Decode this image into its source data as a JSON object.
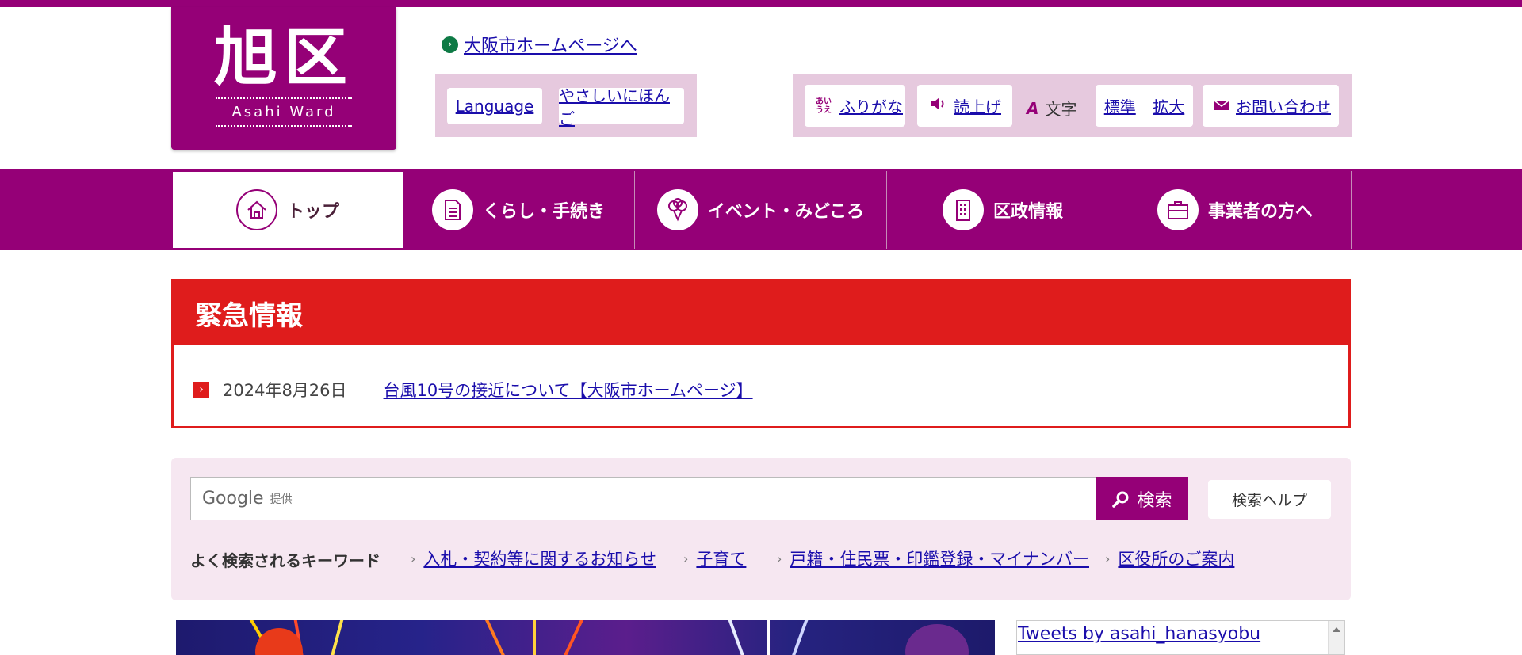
{
  "logo": {
    "kanji": "旭区",
    "english": "Asahi Ward"
  },
  "header": {
    "osaka_link": "大阪市ホームページへ",
    "language": "Language",
    "easy_japanese": "やさしいにほんご",
    "tools": {
      "furigana_icon": "あい\nうえ",
      "furigana": "ふりがな",
      "read_aloud": "読上げ",
      "text_label": "文字",
      "standard": "標準",
      "enlarge": "拡大",
      "contact": "お問い合わせ"
    }
  },
  "nav": {
    "items": [
      {
        "label": "トップ",
        "icon": "house-icon"
      },
      {
        "label": "くらし・手続き",
        "icon": "document-icon"
      },
      {
        "label": "イベント・みどころ",
        "icon": "balloon-icon"
      },
      {
        "label": "区政情報",
        "icon": "building-icon"
      },
      {
        "label": "事業者の方へ",
        "icon": "briefcase-icon"
      }
    ]
  },
  "emergency": {
    "title": "緊急情報",
    "items": [
      {
        "date": "2024年8月26日",
        "text": "台風10号の接近について【大阪市ホームページ】"
      }
    ]
  },
  "search": {
    "google": "Google",
    "provided": "提供",
    "button": "検索",
    "help": "検索ヘルプ",
    "keywords_label": "よく検索されるキーワード",
    "keywords": [
      "入札・契約等に関するお知らせ",
      "子育て",
      "戸籍・住民票・印鑑登録・マイナンバー",
      "区役所のご案内"
    ]
  },
  "tweets": {
    "link": "Tweets by asahi_hanasyobu"
  },
  "colors": {
    "brand": "#950077",
    "emergency": "#df1c1c",
    "lang_box": "#e6c9de",
    "search_bg": "#f6e7f1"
  }
}
